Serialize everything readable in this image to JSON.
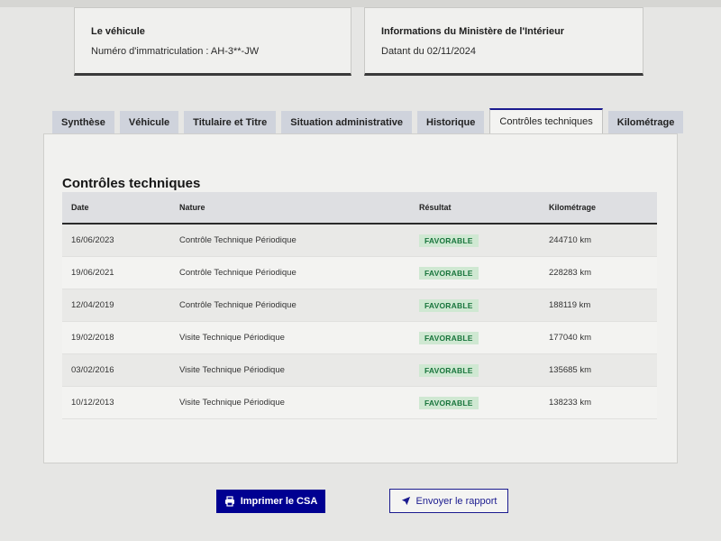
{
  "vehicle_card": {
    "title": "Le véhicule",
    "registration": "Numéro d'immatriculation : AH-3**-JW"
  },
  "ministry_card": {
    "title": "Informations du Ministère de l'Intérieur",
    "date": "Datant du 02/11/2024"
  },
  "tabs": [
    {
      "label": "Synthèse",
      "active": false
    },
    {
      "label": "Véhicule",
      "active": false
    },
    {
      "label": "Titulaire et Titre",
      "active": false
    },
    {
      "label": "Situation administrative",
      "active": false
    },
    {
      "label": "Historique",
      "active": false
    },
    {
      "label": "Contrôles techniques",
      "active": true
    },
    {
      "label": "Kilométrage",
      "active": false
    }
  ],
  "section": {
    "title": "Contrôles techniques",
    "columns": {
      "date": "Date",
      "nature": "Nature",
      "result": "Résultat",
      "mileage": "Kilométrage"
    },
    "rows": [
      {
        "date": "16/06/2023",
        "nature": "Contrôle Technique Périodique",
        "result": "FAVORABLE",
        "mileage": "244710 km"
      },
      {
        "date": "19/06/2021",
        "nature": "Contrôle Technique Périodique",
        "result": "FAVORABLE",
        "mileage": "228283 km"
      },
      {
        "date": "12/04/2019",
        "nature": "Contrôle Technique Périodique",
        "result": "FAVORABLE",
        "mileage": "188119 km"
      },
      {
        "date": "19/02/2018",
        "nature": "Visite Technique Périodique",
        "result": "FAVORABLE",
        "mileage": "177040 km"
      },
      {
        "date": "03/02/2016",
        "nature": "Visite Technique Périodique",
        "result": "FAVORABLE",
        "mileage": "135685 km"
      },
      {
        "date": "10/12/2013",
        "nature": "Visite Technique Périodique",
        "result": "FAVORABLE",
        "mileage": "138233 km"
      }
    ]
  },
  "actions": {
    "print_label": "Imprimer le CSA",
    "print_icon": "printer-icon",
    "send_label": "Envoyer le rapport",
    "send_icon": "send-icon"
  },
  "colors": {
    "primary": "#000091",
    "success_bg": "#cfe8d2",
    "success_text": "#18753c"
  }
}
